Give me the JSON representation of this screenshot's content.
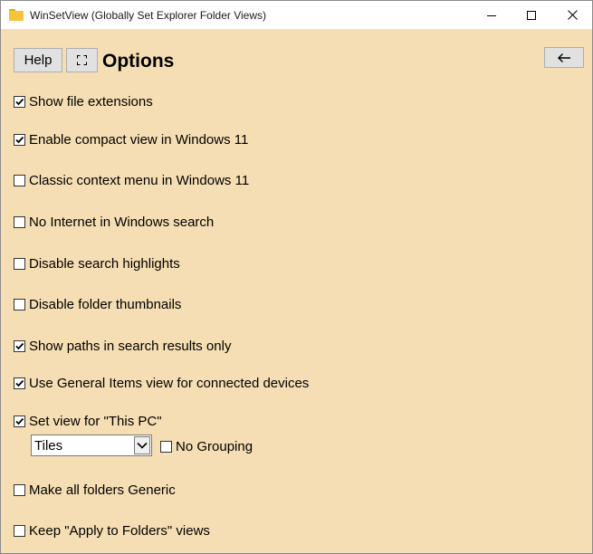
{
  "window": {
    "title": "WinSetView (Globally Set Explorer Folder Views)",
    "icon": "folder-icon",
    "controls": [
      "minimize-icon",
      "maximize-icon",
      "close-icon"
    ]
  },
  "toolbar": {
    "help_label": "Help",
    "fullscreen_icon": "fullscreen-icon",
    "back_icon": "arrow-left-icon",
    "page_title": "Options"
  },
  "options": [
    {
      "label": "Show file extensions",
      "checked": true
    },
    {
      "label": "Enable compact view in Windows 11",
      "checked": true
    },
    {
      "label": "Classic context menu in Windows 11",
      "checked": false
    },
    {
      "label": "No Internet in Windows search",
      "checked": false
    },
    {
      "label": "Disable search highlights",
      "checked": false
    },
    {
      "label": "Disable folder thumbnails",
      "checked": false
    },
    {
      "label": "Show paths in search results only",
      "checked": true
    },
    {
      "label": "Use General Items view for connected devices",
      "checked": true
    },
    {
      "label": "Set view for \"This PC\"",
      "checked": true
    },
    {
      "label": "Make all folders Generic",
      "checked": false
    },
    {
      "label": "Keep \"Apply to Folders\" views",
      "checked": false
    }
  ],
  "this_pc": {
    "view_value": "Tiles",
    "no_grouping_label": "No Grouping",
    "no_grouping_checked": false
  },
  "colors": {
    "background": "#f5deb3",
    "titlebar": "#ffffff",
    "button": "#e1e1e1"
  }
}
